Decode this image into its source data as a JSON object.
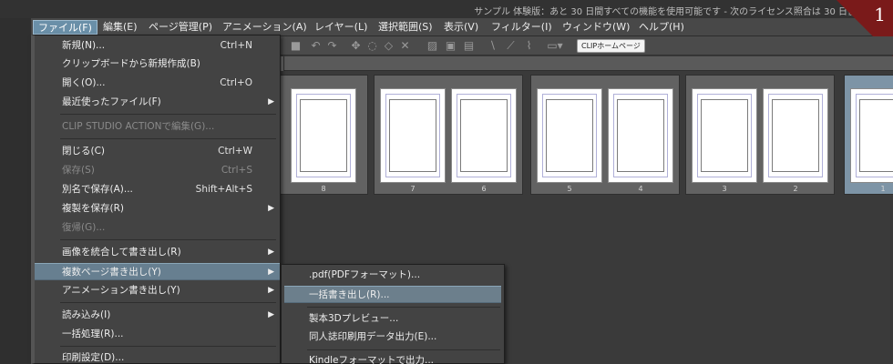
{
  "title_bar": {
    "text": "サンプル 体験版：あと 30 日間すべての機能を使用可能です - 次のライセンス照合は 30 日後"
  },
  "badge": {
    "number": "1",
    "color": "#7a1a1a"
  },
  "menubar": {
    "items": [
      {
        "label": "ファイル(F)",
        "active": true
      },
      {
        "label": "編集(E)"
      },
      {
        "label": "ページ管理(P)"
      },
      {
        "label": "アニメーション(A)"
      },
      {
        "label": "レイヤー(L)"
      },
      {
        "label": "選択範囲(S)"
      },
      {
        "label": "表示(V)"
      },
      {
        "label": "フィルター(I)"
      },
      {
        "label": "ウィンドウ(W)"
      },
      {
        "label": "ヘルプ(H)"
      }
    ]
  },
  "toolbar": {
    "clip_button": "CLIPホームページ"
  },
  "pages": {
    "spreads": [
      {
        "numbers": [
          "8"
        ]
      },
      {
        "numbers": [
          "7",
          "6"
        ]
      },
      {
        "numbers": [
          "5",
          "4"
        ]
      },
      {
        "numbers": [
          "3",
          "2"
        ]
      },
      {
        "numbers": [
          "1"
        ],
        "selected": true
      }
    ]
  },
  "file_menu": {
    "items": [
      {
        "label": "新規(N)...",
        "shortcut": "Ctrl+N"
      },
      {
        "label": "クリップボードから新規作成(B)"
      },
      {
        "label": "開く(O)...",
        "shortcut": "Ctrl+O"
      },
      {
        "label": "最近使ったファイル(F)",
        "submenu": true
      },
      {
        "label": "CLIP STUDIO ACTIONで編集(G)...",
        "disabled": true
      },
      {
        "label": "閉じる(C)",
        "shortcut": "Ctrl+W"
      },
      {
        "label": "保存(S)",
        "shortcut": "Ctrl+S",
        "disabled": true
      },
      {
        "label": "別名で保存(A)...",
        "shortcut": "Shift+Alt+S"
      },
      {
        "label": "複製を保存(R)",
        "submenu": true
      },
      {
        "label": "復帰(G)...",
        "disabled": true
      },
      {
        "label": "画像を統合して書き出し(R)",
        "submenu": true
      },
      {
        "label": "複数ページ書き出し(Y)",
        "submenu": true,
        "highlighted": true
      },
      {
        "label": "アニメーション書き出し(Y)",
        "submenu": true
      },
      {
        "label": "読み込み(I)",
        "submenu": true
      },
      {
        "label": "一括処理(R)..."
      },
      {
        "label": "印刷設定(D)..."
      }
    ]
  },
  "sub_menu": {
    "items": [
      {
        "label": ".pdf(PDFフォーマット)..."
      },
      {
        "label": "一括書き出し(R)...",
        "highlighted": true
      },
      {
        "label": "製本3Dプレビュー..."
      },
      {
        "label": "同人誌印刷用データ出力(E)..."
      },
      {
        "label": "Kindleフォーマットで出力..."
      }
    ]
  },
  "icons": {
    "submenu_arrow": "▶",
    "toolbar": [
      "stop-icon",
      "undo-icon",
      "redo-icon",
      "transform-icon",
      "lasso-icon",
      "selection-icon",
      "clear-icon",
      "fill-icon",
      "layer-icon",
      "ruler-icon",
      "pen-icon",
      "brush-icon",
      "canvas-icon"
    ]
  }
}
